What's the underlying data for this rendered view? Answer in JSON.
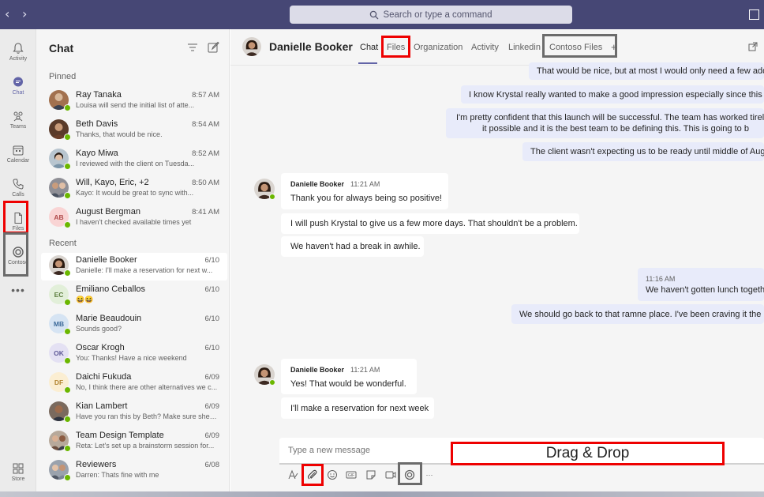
{
  "titlebar": {
    "search_placeholder": "Search or type a command",
    "colors": {
      "bar": "#464775"
    }
  },
  "rail": {
    "items": [
      {
        "label": "Activity",
        "icon": "bell-icon"
      },
      {
        "label": "Chat",
        "icon": "chat-icon"
      },
      {
        "label": "Teams",
        "icon": "teams-icon"
      },
      {
        "label": "Calendar",
        "icon": "calendar-icon"
      },
      {
        "label": "Calls",
        "icon": "phone-icon"
      },
      {
        "label": "Files",
        "icon": "file-icon"
      },
      {
        "label": "Contoso",
        "icon": "contoso-icon"
      }
    ],
    "more": "•••",
    "store": "Store"
  },
  "chatlist": {
    "title": "Chat",
    "pinned_label": "Pinned",
    "recent_label": "Recent",
    "pinned": [
      {
        "name": "Ray Tanaka",
        "time": "8:57 AM",
        "preview": "Louisa will send the initial list of atte..."
      },
      {
        "name": "Beth Davis",
        "time": "8:54 AM",
        "preview": "Thanks, that would be nice."
      },
      {
        "name": "Kayo Miwa",
        "time": "8:52 AM",
        "preview": "I reviewed with the client on Tuesda..."
      },
      {
        "name": "Will, Kayo, Eric, +2",
        "time": "8:50 AM",
        "preview": "Kayo: It would be great to sync with..."
      },
      {
        "name": "August Bergman",
        "time": "8:41 AM",
        "preview": "I haven't checked available times yet",
        "initials": "AB"
      }
    ],
    "recent": [
      {
        "name": "Danielle Booker",
        "time": "6/10",
        "preview": "Danielle: I'll make a reservation for next w..."
      },
      {
        "name": "Emiliano Ceballos",
        "time": "6/10",
        "preview": "😆😆",
        "initials": "EC"
      },
      {
        "name": "Marie Beaudouin",
        "time": "6/10",
        "preview": "Sounds good?",
        "initials": "MB"
      },
      {
        "name": "Oscar Krogh",
        "time": "6/10",
        "preview": "You: Thanks! Have a nice weekend",
        "initials": "OK"
      },
      {
        "name": "Daichi Fukuda",
        "time": "6/09",
        "preview": "No, I think there are other alternatives we c...",
        "initials": "DF"
      },
      {
        "name": "Kian Lambert",
        "time": "6/09",
        "preview": "Have you ran this by Beth? Make sure she is..."
      },
      {
        "name": "Team Design Template",
        "time": "6/09",
        "preview": "Reta: Let's set up a brainstorm session for..."
      },
      {
        "name": "Reviewers",
        "time": "6/08",
        "preview": "Darren: Thats fine with me"
      }
    ]
  },
  "header": {
    "name": "Danielle Booker",
    "tabs": [
      "Chat",
      "Files",
      "Organization",
      "Activity",
      "Linkedin",
      "Contoso Files"
    ],
    "add": "+"
  },
  "messages": {
    "mine_top": [
      "That would be nice, but at most I would only need a few add",
      "I know Krystal really wanted to make a good impression especially since this is a",
      "I'm pretty confident that this launch will be successful. The team has worked tireles",
      "it possible and it is the best team to be defining this. This is going to b",
      "The client wasn't expecting us to be ready until middle of Augu"
    ],
    "theirs_1": {
      "author": "Danielle Booker",
      "time": "11:21 AM",
      "lines": [
        "Thank you for always being so positive!",
        "I will push Krystal to give us a few more days. That shouldn't be a problem.",
        "We haven't had a break in awhile."
      ]
    },
    "mine_mid": {
      "time": "11:16 AM",
      "lines": [
        "We haven't gotten lunch togeth",
        "We should go back to that ramne place. I've been craving it the la"
      ]
    },
    "theirs_2": {
      "author": "Danielle Booker",
      "time": "11:21 AM",
      "lines": [
        "Yes! That would be wonderful.",
        "I'll make a reservation for next week"
      ]
    }
  },
  "compose": {
    "placeholder": "Type a new message",
    "dragdrop_label": "Drag & Drop",
    "toolbar": [
      "format-icon",
      "attach-icon",
      "emoji-icon",
      "gif-icon",
      "sticker-icon",
      "meet-icon",
      "contoso-icon",
      "more-icon"
    ],
    "more": "···"
  }
}
